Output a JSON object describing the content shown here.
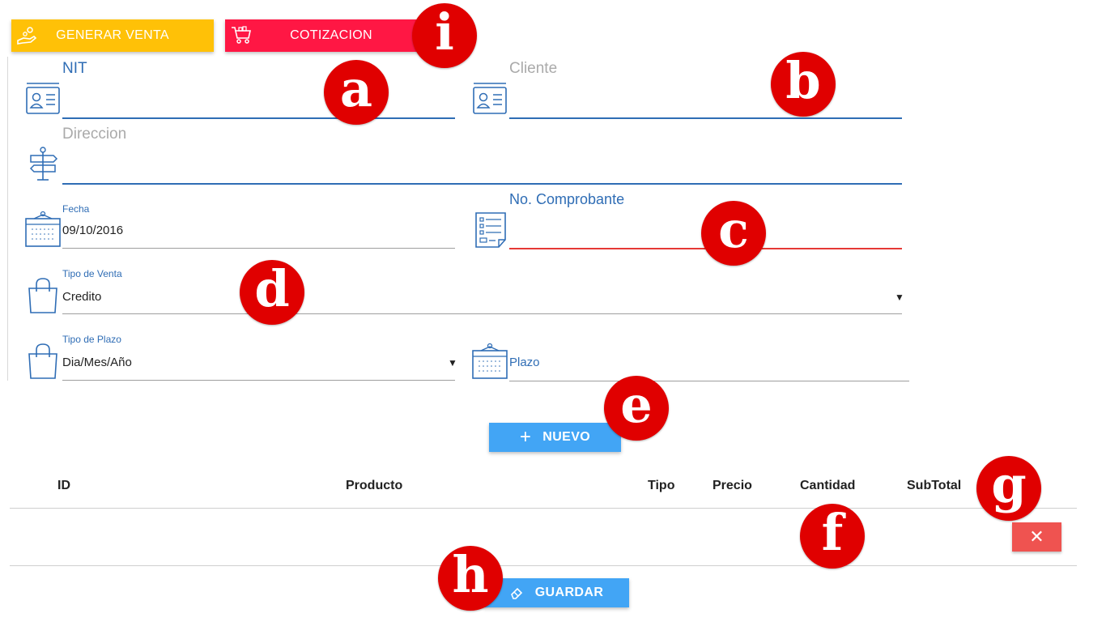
{
  "top_buttons": {
    "generar_venta": "GENERAR VENTA",
    "cotizacion": "COTIZACION"
  },
  "form": {
    "nit": {
      "label": "NIT",
      "value": ""
    },
    "cliente": {
      "label": "Cliente",
      "value": ""
    },
    "direccion": {
      "label": "Direccion",
      "value": ""
    },
    "fecha": {
      "label": "Fecha",
      "value": "09/10/2016"
    },
    "no_comprobante": {
      "label": "No. Comprobante",
      "value": ""
    },
    "tipo_venta": {
      "label": "Tipo de Venta",
      "value": "Credito"
    },
    "tipo_plazo": {
      "label": "Tipo de Plazo",
      "value": "Dia/Mes/Año"
    },
    "plazo": {
      "placeholder": "Plazo"
    }
  },
  "buttons": {
    "nuevo": "NUEVO",
    "guardar": "GUARDAR",
    "delete_glyph": "✕"
  },
  "table": {
    "headers": [
      "ID",
      "Producto",
      "Tipo",
      "Precio",
      "Cantidad",
      "SubTotal"
    ],
    "rows": []
  },
  "markers": [
    "a",
    "b",
    "c",
    "d",
    "e",
    "f",
    "g",
    "h",
    "i"
  ],
  "colors": {
    "generar_venta": "#FFC107",
    "cotizacion": "#FF1744",
    "primary_blue": "#42A5F5",
    "field_blue": "#2f6db5",
    "error_red": "#e53935",
    "delete_red": "#EF5350",
    "marker_red": "#e00000"
  }
}
